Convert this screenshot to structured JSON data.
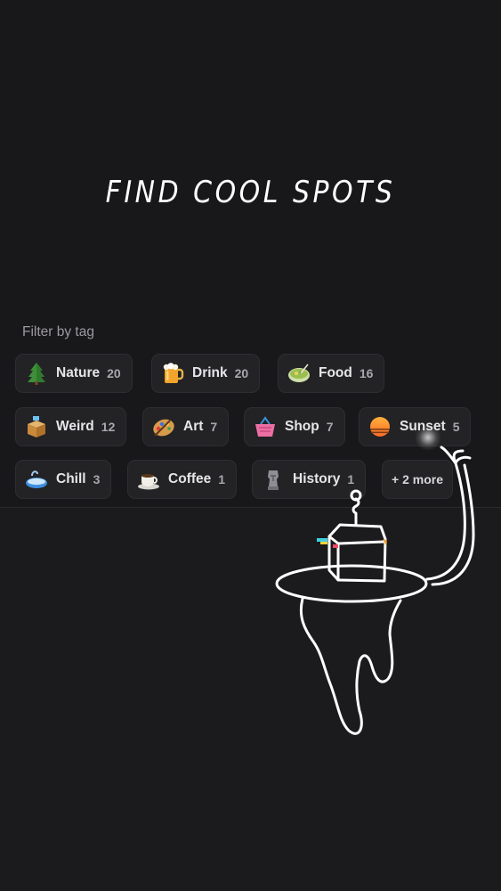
{
  "hero": {
    "title": "FIND COOL SPOTS"
  },
  "filter": {
    "label": "Filter by tag",
    "tags": [
      {
        "label": "Nature",
        "count": "20",
        "icon": "tree-icon"
      },
      {
        "label": "Drink",
        "count": "20",
        "icon": "beer-mug-icon"
      },
      {
        "label": "Food",
        "count": "16",
        "icon": "food-bowl-icon"
      },
      {
        "label": "Weird",
        "count": "12",
        "icon": "ballot-box-icon"
      },
      {
        "label": "Art",
        "count": "7",
        "icon": "palette-icon"
      },
      {
        "label": "Shop",
        "count": "7",
        "icon": "shopping-basket-icon"
      },
      {
        "label": "Sunset",
        "count": "5",
        "icon": "sunset-icon"
      },
      {
        "label": "Chill",
        "count": "3",
        "icon": "bathtub-icon"
      },
      {
        "label": "Coffee",
        "count": "1",
        "icon": "coffee-cup-icon"
      },
      {
        "label": "History",
        "count": "1",
        "icon": "moai-statue-icon"
      }
    ],
    "more_label": "+ 2 more"
  },
  "colors": {
    "background_top": "#18171a",
    "background_bottom": "#1b1a1c",
    "chip_background": "#232225",
    "text_primary": "#e6e5e8",
    "text_muted": "#9c9a9f"
  }
}
